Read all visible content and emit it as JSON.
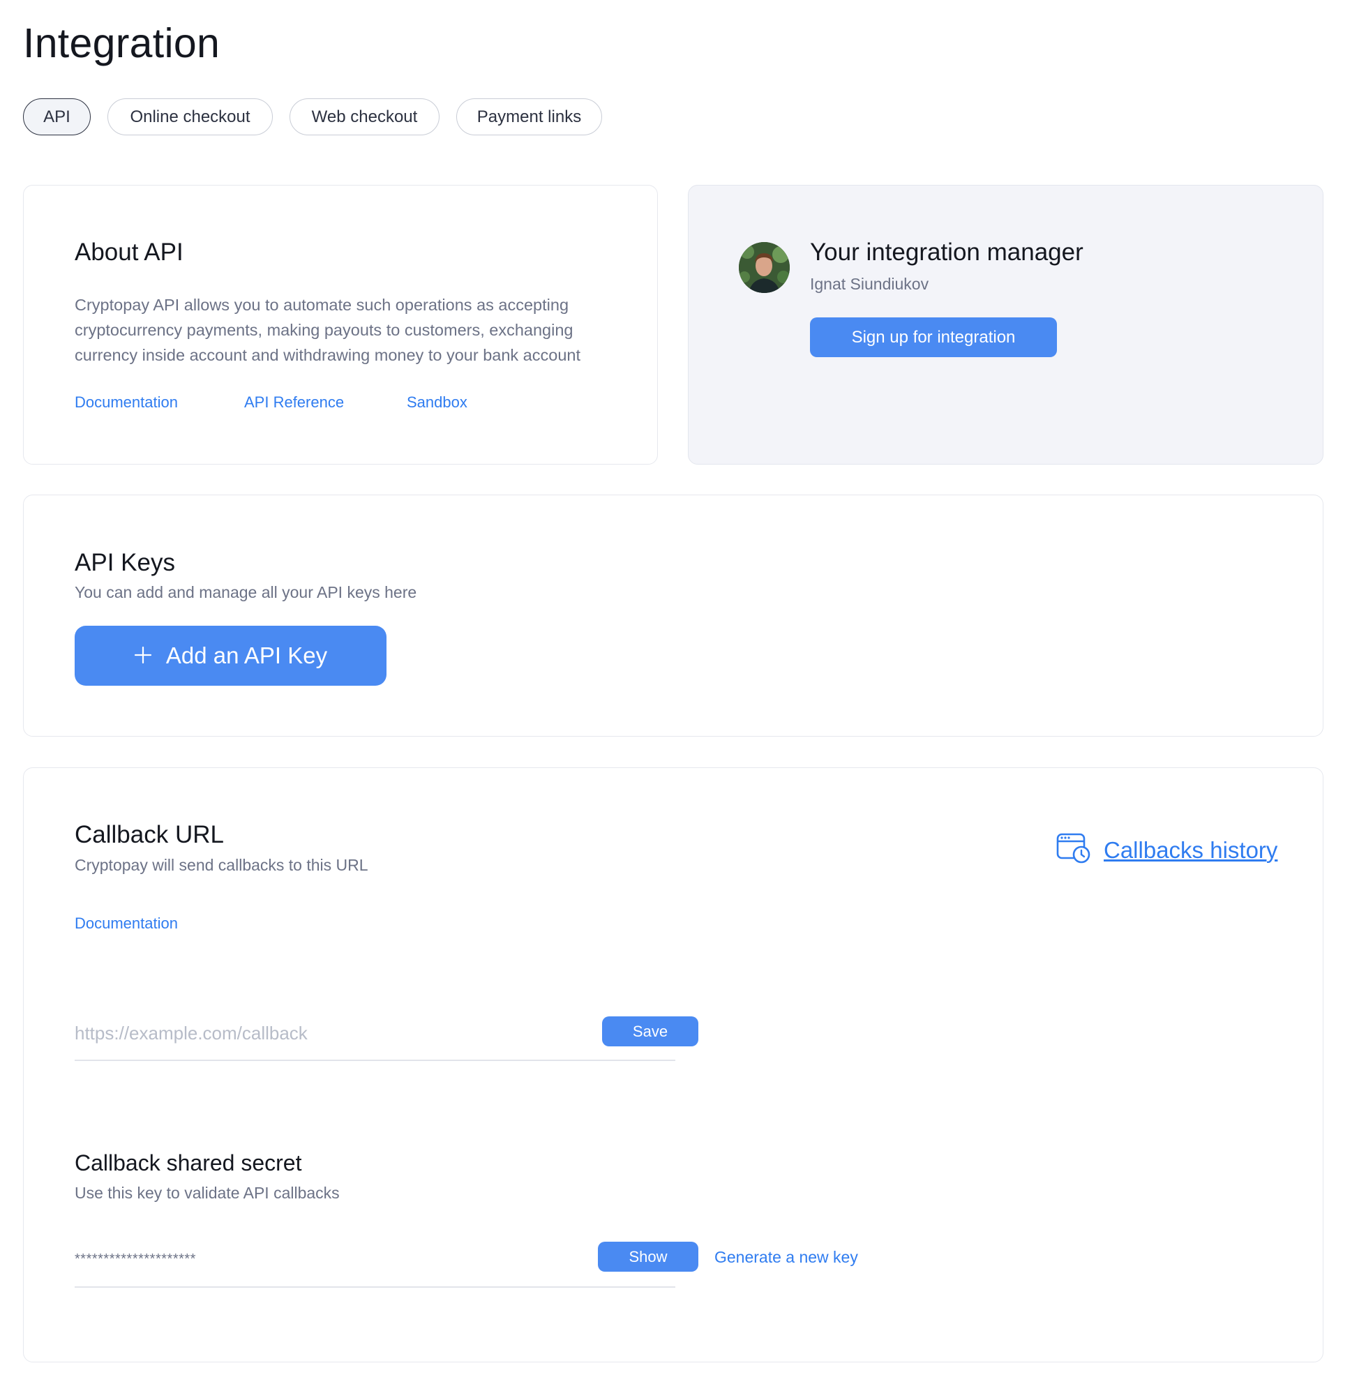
{
  "page": {
    "title": "Integration"
  },
  "tabs": [
    {
      "label": "API",
      "active": true
    },
    {
      "label": "Online checkout",
      "active": false
    },
    {
      "label": "Web checkout",
      "active": false
    },
    {
      "label": "Payment links",
      "active": false
    }
  ],
  "about": {
    "title": "About API",
    "description": "Cryptopay API allows you to automate such operations as accepting cryptocurrency payments, making payouts to customers, exchanging currency inside account and withdrawing money to your bank account",
    "links": {
      "documentation": "Documentation",
      "api_reference": "API Reference",
      "sandbox": "Sandbox"
    }
  },
  "manager": {
    "title": "Your integration manager",
    "name": "Ignat Siundiukov",
    "signup_label": "Sign up for integration"
  },
  "api_keys": {
    "title": "API Keys",
    "subtitle": "You can add and manage all your API keys here",
    "add_label": "Add an API Key",
    "add_icon": "plus-icon"
  },
  "callback": {
    "title": "Callback URL",
    "subtitle": "Cryptopay will send callbacks to this URL",
    "documentation_label": "Documentation",
    "history_label": "Callbacks history",
    "history_icon": "calendar-clock-icon",
    "url_placeholder": "https://example.com/callback",
    "url_value": "",
    "save_label": "Save"
  },
  "secret": {
    "title": "Callback shared secret",
    "subtitle": "Use this key to validate API callbacks",
    "masked_value": "*********************",
    "show_label": "Show",
    "generate_label": "Generate a new key"
  },
  "colors": {
    "accent": "#4a8af2",
    "link": "#2f7cf0",
    "muted_text": "#6c7286",
    "manager_bg": "#f3f4f9"
  }
}
